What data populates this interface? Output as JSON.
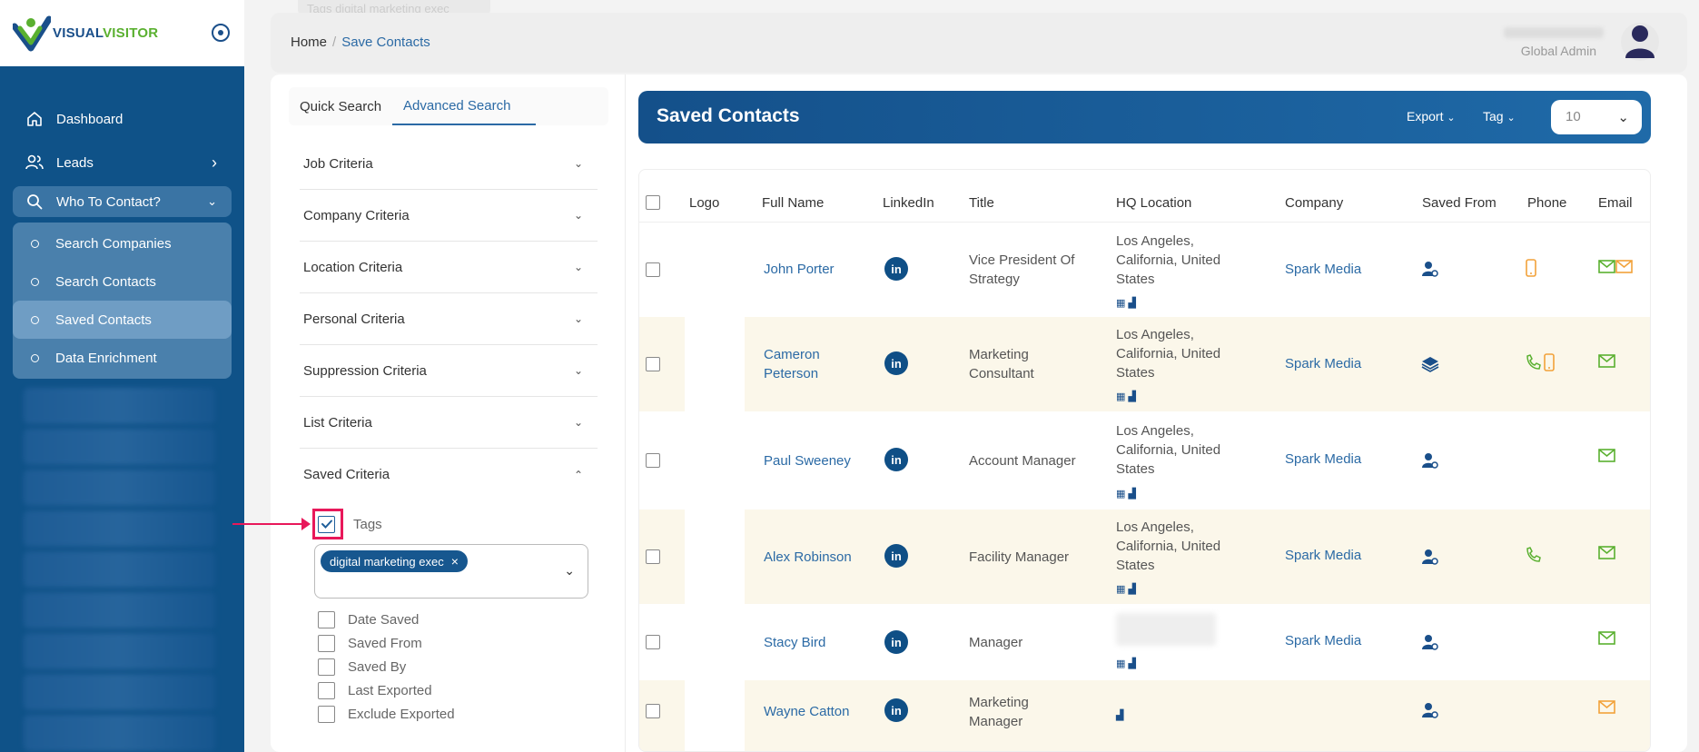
{
  "brand": {
    "part1": "VISUAL",
    "part2": "VISITOR"
  },
  "sidebar": {
    "items": [
      {
        "label": "Dashboard",
        "icon": "home-icon"
      },
      {
        "label": "Leads",
        "icon": "users-icon"
      },
      {
        "label": "Who To Contact?",
        "icon": "search-icon"
      }
    ],
    "sub_items": [
      {
        "label": "Search Companies"
      },
      {
        "label": "Search Contacts"
      },
      {
        "label": "Saved Contacts"
      },
      {
        "label": "Data Enrichment"
      }
    ]
  },
  "top_pill": "Tags digital marketing exec",
  "breadcrumb": {
    "home": "Home",
    "sep": "/",
    "current": "Save Contacts"
  },
  "user": {
    "role": "Global Admin"
  },
  "filters": {
    "tabs": [
      {
        "label": "Quick Search"
      },
      {
        "label": "Advanced Search"
      }
    ],
    "criteria": [
      "Job Criteria",
      "Company Criteria",
      "Location Criteria",
      "Personal Criteria",
      "Suppression Criteria",
      "List Criteria",
      "Saved Criteria"
    ],
    "tags_label": "Tags",
    "tag_chip": "digital marketing exec",
    "options": [
      "Date Saved",
      "Saved From",
      "Saved By",
      "Last Exported",
      "Exclude Exported"
    ]
  },
  "contacts": {
    "title": "Saved Contacts",
    "export_label": "Export",
    "tag_label": "Tag",
    "per_page": "10",
    "columns": [
      "Logo",
      "Full Name",
      "LinkedIn",
      "Title",
      "HQ Location",
      "Company",
      "Saved From",
      "Phone",
      "Email"
    ],
    "rows": [
      {
        "name1": "John Porter",
        "name2": "",
        "title1": "Vice President Of",
        "title2": "Strategy",
        "loc": [
          "Los Angeles,",
          "California, United",
          "States"
        ],
        "company": "Spark Media",
        "saved_icon": "person-search-icon",
        "phone": "mobile",
        "email": "double"
      },
      {
        "name1": "Cameron",
        "name2": "Peterson",
        "title1": "Marketing",
        "title2": "Consultant",
        "loc": [
          "Los Angeles,",
          "California, United",
          "States"
        ],
        "company": "Spark Media",
        "saved_icon": "layers-icon",
        "phone": "both",
        "email": "single"
      },
      {
        "name1": "Paul Sweeney",
        "name2": "",
        "title1": "Account Manager",
        "title2": "",
        "loc": [
          "Los Angeles,",
          "California, United",
          "States"
        ],
        "company": "Spark Media",
        "saved_icon": "person-search-icon",
        "phone": "none",
        "email": "single"
      },
      {
        "name1": "Alex Robinson",
        "name2": "",
        "title1": "Facility Manager",
        "title2": "",
        "loc": [
          "Los Angeles,",
          "California, United",
          "States"
        ],
        "company": "Spark Media",
        "saved_icon": "person-search-icon",
        "phone": "landline",
        "email": "single"
      },
      {
        "name1": "Stacy Bird",
        "name2": "",
        "title1": "Manager",
        "title2": "",
        "loc": [],
        "company": "Spark Media",
        "saved_icon": "person-search-icon",
        "phone": "none",
        "email": "single"
      },
      {
        "name1": "Wayne Catton",
        "name2": "",
        "title1": "Marketing",
        "title2": "Manager",
        "loc": [],
        "company": "",
        "saved_icon": "person-search-icon",
        "phone": "none",
        "email": "orange"
      }
    ]
  },
  "colors": {
    "primary": "#0f5288",
    "accent": "#2b6aa5",
    "green": "#5ab030",
    "orange": "#f2a23a",
    "highlight": "#e8185a"
  }
}
